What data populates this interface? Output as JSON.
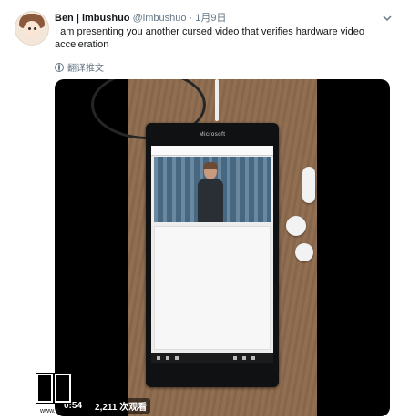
{
  "tweet": {
    "author_name": "Ben | imbushuo",
    "handle": "@imbushuo",
    "separator": "·",
    "date": "1月9日",
    "text": "I am presenting you another cursed video that verifies hardware video acceleration",
    "translate_label": "翻译推文"
  },
  "phone": {
    "brand": "Microsoft"
  },
  "video": {
    "time": "0:54",
    "views": "2,211 次观看"
  },
  "watermark": {
    "text": "www.it..."
  },
  "icons": {
    "menu": "chevron-down-icon",
    "translate": "globe-icon"
  },
  "colors": {
    "text": "#14171a",
    "secondary": "#657786",
    "video_bg": "#000000"
  }
}
